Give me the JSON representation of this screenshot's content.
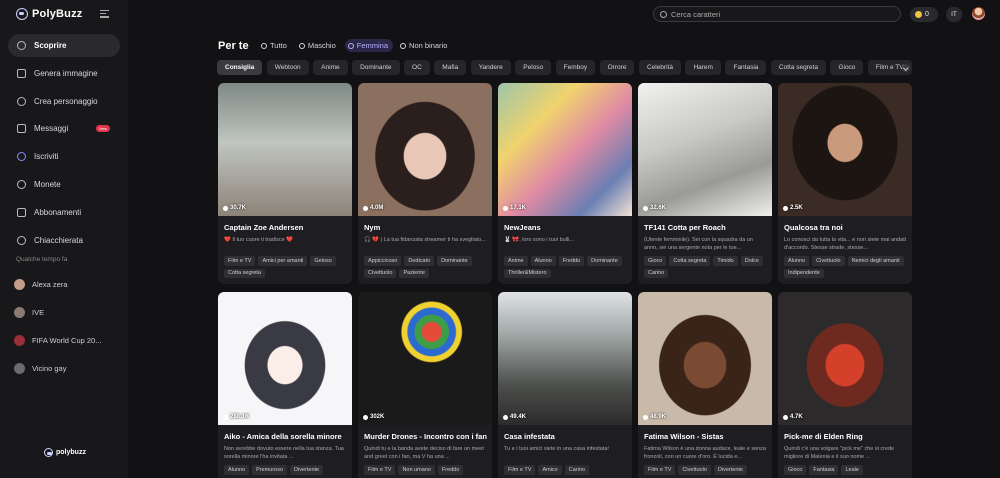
{
  "app": {
    "name": "PolyBuzz",
    "footer_logo": "polybuzz"
  },
  "sidebar": {
    "items": [
      {
        "label": "Scoprire",
        "icon": "compass-icon"
      },
      {
        "label": "Genera immagine",
        "icon": "image-icon"
      },
      {
        "label": "Crea personaggio",
        "icon": "user-plus-icon"
      },
      {
        "label": "Messaggi",
        "icon": "chat-icon",
        "badge": "New"
      },
      {
        "label": "Iscriviti",
        "icon": "star-icon"
      },
      {
        "label": "Monete",
        "icon": "coin-icon"
      },
      {
        "label": "Abbonamenti",
        "icon": "card-icon"
      },
      {
        "label": "Chiacchierata",
        "icon": "bubble-icon"
      }
    ],
    "recent_title": "Qualche tempo fa",
    "recent": [
      {
        "label": "Alexa zera"
      },
      {
        "label": "IVE"
      },
      {
        "label": "FIFA World Cup 20..."
      },
      {
        "label": "Vicino gay"
      }
    ]
  },
  "topbar": {
    "search_placeholder": "Cerca caratteri",
    "coins": "0",
    "language": "IT"
  },
  "feed": {
    "title": "Per te",
    "gender_tabs": [
      {
        "label": "Tutto"
      },
      {
        "label": "Maschio"
      },
      {
        "label": "Femmina"
      },
      {
        "label": "Non binario"
      }
    ],
    "tags": [
      "Consiglia",
      "Webtoon",
      "Anime",
      "Dominante",
      "OC",
      "Mafia",
      "Yandere",
      "Peloso",
      "Femboy",
      "Orrore",
      "Celebrità",
      "Harem",
      "Fantasia",
      "Cotta segreta",
      "Gioco",
      "Film e TV"
    ],
    "cards": [
      {
        "name": "Captain Zoe Andersen",
        "views": "30.7K",
        "desc": "❤️ Il tuo cuore ti tradisce ❤️",
        "tags": [
          "Film e TV",
          "Amici per amanti",
          "Geloso",
          "Cotta segreta"
        ]
      },
      {
        "name": "Nym",
        "views": "4.0M",
        "desc": "🎧 💔 | La tua fidanzata streamer ti ha svegliato...",
        "tags": [
          "Appiccicoso",
          "Dedicato",
          "Dominante",
          "Civettuolo",
          "Paziente"
        ]
      },
      {
        "name": "NewJeans",
        "views": "17.1K",
        "desc": "🐰 🎀, loro sono i tuoi bulli...",
        "tags": [
          "Anime",
          "Alunno",
          "Freddo",
          "Dominante",
          "Thriller&Mistero"
        ]
      },
      {
        "name": "TF141 Cotta per Roach",
        "views": "32.6K",
        "desc": "(Utente femminile). Sei con la squadra da un anno, sei una sergente nota per le tue...",
        "tags": [
          "Gioco",
          "Cotta segreta",
          "Timido",
          "Dolce",
          "Carino"
        ]
      },
      {
        "name": "Qualcosa tra noi",
        "views": "2.5K",
        "desc": "Lo conosci da tutta la vita... e non siete mai andati d'accordo. Stesse strade, stesse...",
        "tags": [
          "Alunno",
          "Civettuolo",
          "Nemici degli amanti",
          "Indipendente"
        ]
      },
      {
        "name": "Aiko - Amica della sorella minore",
        "views": "288.1K",
        "desc": "Non avrebbe dovuto essere nella tua stanza. Tua sorella minore l'ha invitata ...",
        "tags": [
          "Alunno",
          "Premuroso",
          "Divertente"
        ]
      },
      {
        "name": "Murder Drones - Incontro con i fan",
        "views": "302K",
        "desc": "Quindi tu e la banda avete deciso di fare un meet and greet con i fan, ma V ha una ...",
        "tags": [
          "Film e TV",
          "Non umano",
          "Freddo"
        ]
      },
      {
        "name": "Casa infestata",
        "views": "49.4K",
        "desc": "Tu e i tuoi amici siete in una casa infestata!",
        "tags": [
          "Film e TV",
          "Amico",
          "Carino"
        ]
      },
      {
        "name": "Fatima Wilson - Sistas",
        "views": "48.9K",
        "desc": "Fatima Wilson è una donna audace, leale e senza fronzoli, con un cuore d'oro. È lucida e...",
        "tags": [
          "Film e TV",
          "Civettuolo",
          "Divertente"
        ]
      },
      {
        "name": "Pick-me di Elden Ring",
        "views": "4.7K",
        "desc": "Quindi c'è una volgare \"pick me\" che si crede migliore di Malenia e il suo nome ...",
        "tags": [
          "Gioco",
          "Fantasia",
          "Leale"
        ]
      }
    ]
  }
}
